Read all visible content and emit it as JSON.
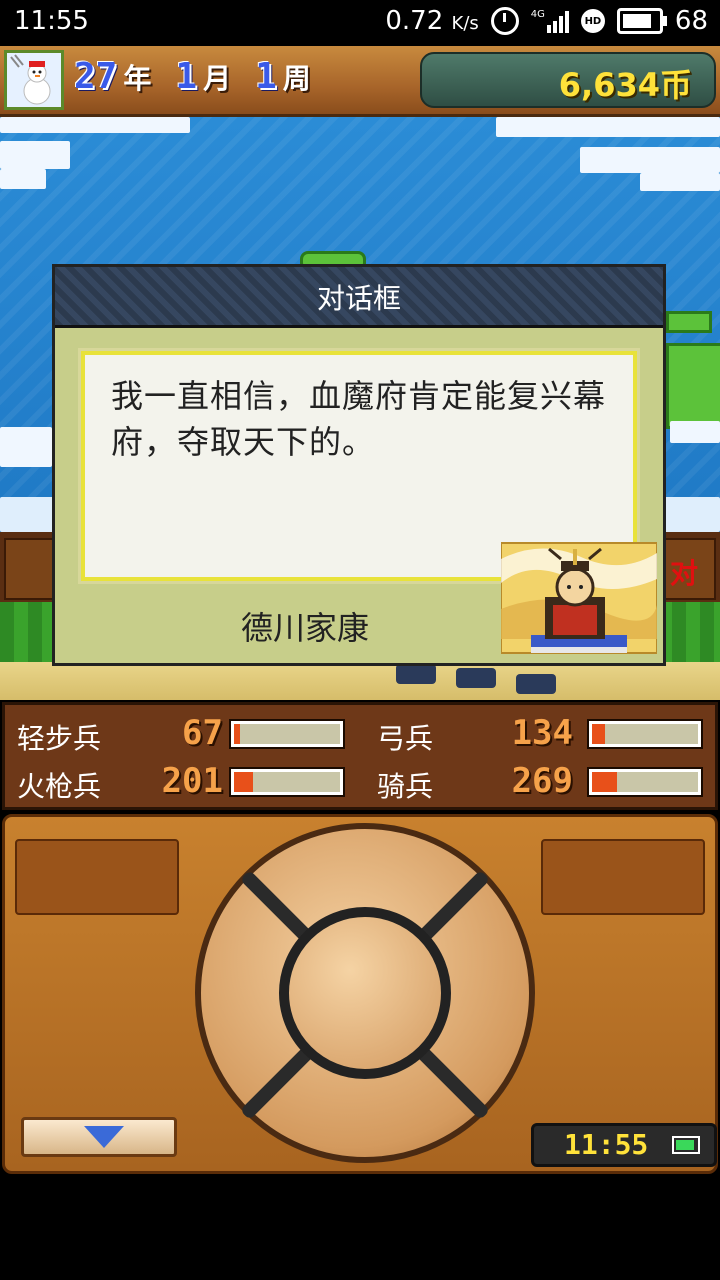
{
  "status_bar": {
    "time": "11:55",
    "net_speed": "0.72",
    "net_unit": "K/s",
    "signal_label": "4G",
    "hd_label": "HD",
    "battery": "68"
  },
  "top_bar": {
    "year": "27",
    "year_unit": "年",
    "month": "1",
    "month_unit": "月",
    "week": "1",
    "week_unit": "周",
    "money": "6,634币"
  },
  "dialog": {
    "title": "对话框",
    "text": "我一直相信，血魔府肯定能复兴幕府，夺取天下的。",
    "speaker": "德川家康"
  },
  "background": {
    "banner_text": "对"
  },
  "troops": [
    {
      "name": "轻步兵",
      "value": "67",
      "fill_pct": 6
    },
    {
      "name": "弓兵",
      "value": "134",
      "fill_pct": 12
    },
    {
      "name": "火枪兵",
      "value": "201",
      "fill_pct": 18
    },
    {
      "name": "骑兵",
      "value": "269",
      "fill_pct": 24
    }
  ],
  "controller": {
    "clock": "11:55"
  },
  "colors": {
    "money_text": "#ffe23a",
    "troop_value": "#f6a24a",
    "troop_bar_fill": "#e8501a",
    "date_numbers": "#3a5ae8"
  }
}
